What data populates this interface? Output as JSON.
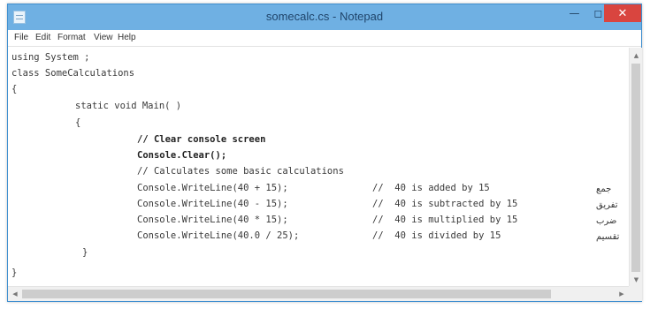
{
  "window": {
    "title": "somecalc.cs - Notepad",
    "icons": {
      "app": "notepad-icon",
      "minimize": "minimize-icon",
      "maximize": "maximize-icon",
      "close": "close-icon"
    },
    "colors": {
      "titlebar": "#6fb0e3",
      "close_button": "#d9453f"
    }
  },
  "menu": {
    "items": [
      {
        "label": "File"
      },
      {
        "label": "Edit"
      },
      {
        "label": "Format"
      },
      {
        "label": "View"
      },
      {
        "label": "Help"
      }
    ]
  },
  "code": {
    "lines": [
      {
        "text": "using System ;"
      },
      {
        "text": "class SomeCalculations"
      },
      {
        "text": "{"
      },
      {
        "text": "static void Main( )"
      },
      {
        "text": "{"
      },
      {
        "text": "// Clear console screen"
      },
      {
        "text": "Console.Clear();"
      },
      {
        "text": "// Calculates some basic calculations"
      },
      {
        "text": "Console.WriteLine(40 + 15);",
        "comment": "//  40 is added by 15",
        "annotation": "جمع"
      },
      {
        "text": "Console.WriteLine(40 - 15);",
        "comment": "//  40 is subtracted by 15",
        "annotation": "تفریق"
      },
      {
        "text": "Console.WriteLine(40 * 15);",
        "comment": "//  40 is multiplied by 15",
        "annotation": "ضرب"
      },
      {
        "text": "Console.WriteLine(40.0 / 25);",
        "comment": "//  40 is divided by 15",
        "annotation": "تقسیم"
      },
      {
        "text": "}"
      },
      {
        "text": "}"
      }
    ]
  },
  "scrollbars": {
    "vertical": {
      "up": "arrow-up-icon",
      "down": "arrow-down-icon"
    },
    "horizontal": {
      "left": "arrow-left-icon",
      "right": "arrow-right-icon"
    }
  }
}
